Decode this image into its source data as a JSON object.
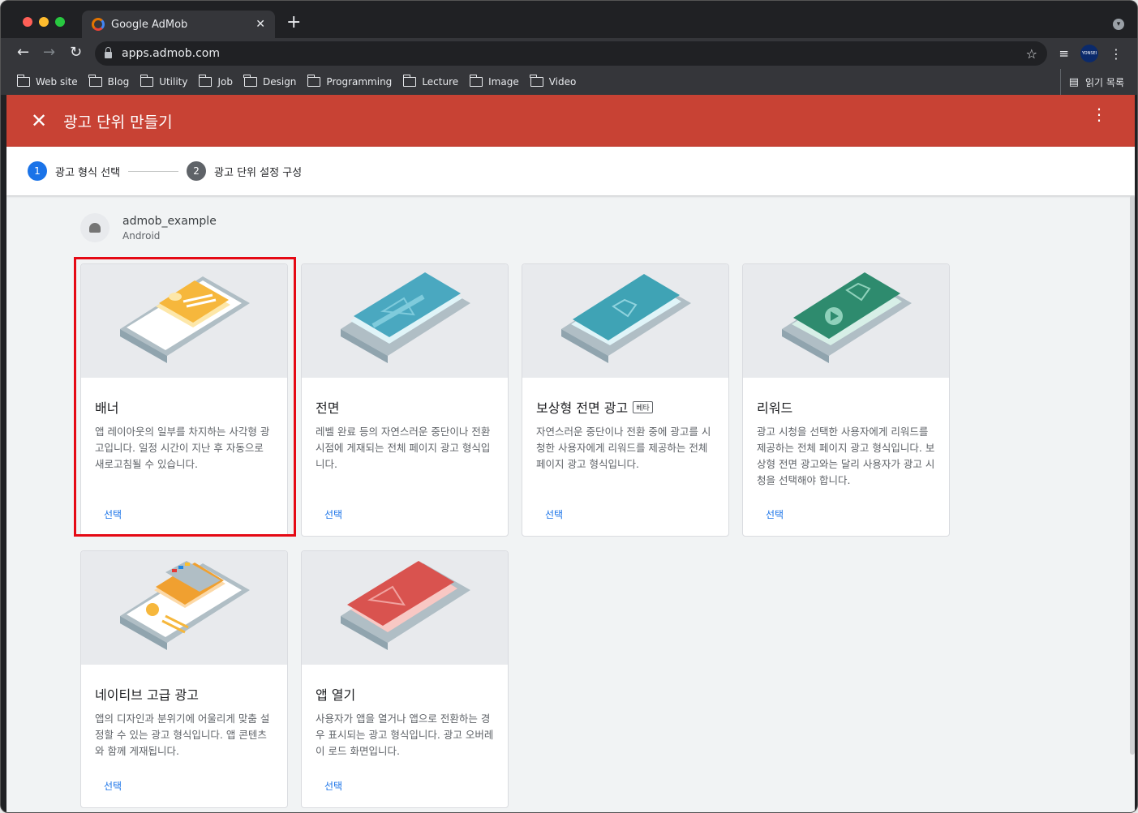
{
  "browser": {
    "tab_title": "Google AdMob",
    "url": "apps.admob.com",
    "bookmarks": [
      {
        "label": "Web site"
      },
      {
        "label": "Blog"
      },
      {
        "label": "Utility"
      },
      {
        "label": "Job"
      },
      {
        "label": "Design"
      },
      {
        "label": "Programming"
      },
      {
        "label": "Lecture"
      },
      {
        "label": "Image"
      },
      {
        "label": "Video"
      }
    ],
    "reading_list": "읽기 목록",
    "avatar_text": "YONSEI"
  },
  "appbar": {
    "title": "광고 단위 만들기",
    "color": "#c84234"
  },
  "stepper": {
    "steps": [
      {
        "number": "1",
        "label": "광고 형식 선택",
        "active": true
      },
      {
        "number": "2",
        "label": "광고 단위 설정 구성",
        "active": false
      }
    ]
  },
  "app": {
    "name": "admob_example",
    "platform": "Android"
  },
  "formats": [
    {
      "title": "배너",
      "badge": "",
      "description": "앱 레이아웃의 일부를 차지하는 사각형 광고입니다. 일정 시간이 지난 후 자동으로 새로고침될 수 있습니다.",
      "action": "선택",
      "selected": true,
      "accent": "#f6b73c"
    },
    {
      "title": "전면",
      "badge": "",
      "description": "레벨 완료 등의 자연스러운 중단이나 전환 시점에 게재되는 전체 페이지 광고 형식입니다.",
      "action": "선택",
      "selected": false,
      "accent": "#4aa8c0"
    },
    {
      "title": "보상형 전면 광고",
      "badge": "베타",
      "description": "자연스러운 중단이나 전환 중에 광고를 시청한 사용자에게 리워드를 제공하는 전체 페이지 광고 형식입니다.",
      "action": "선택",
      "selected": false,
      "accent": "#3fa3b5"
    },
    {
      "title": "리워드",
      "badge": "",
      "description": "광고 시청을 선택한 사용자에게 리워드를 제공하는 전체 페이지 광고 형식입니다. 보상형 전면 광고와는 달리 사용자가 광고 시청을 선택해야 합니다.",
      "action": "선택",
      "selected": false,
      "accent": "#2e8b6e"
    },
    {
      "title": "네이티브 고급 광고",
      "badge": "",
      "description": "앱의 디자인과 분위기에 어울리게 맞춤 설정할 수 있는 광고 형식입니다. 앱 콘텐츠와 함께 게재됩니다.",
      "action": "선택",
      "selected": false,
      "accent": "#f0a030"
    },
    {
      "title": "앱 열기",
      "badge": "",
      "description": "사용자가 앱을 열거나 앱으로 전환하는 경우 표시되는 광고 형식입니다. 광고 오버레이 로드 화면입니다.",
      "action": "선택",
      "selected": false,
      "accent": "#d9534f"
    }
  ]
}
